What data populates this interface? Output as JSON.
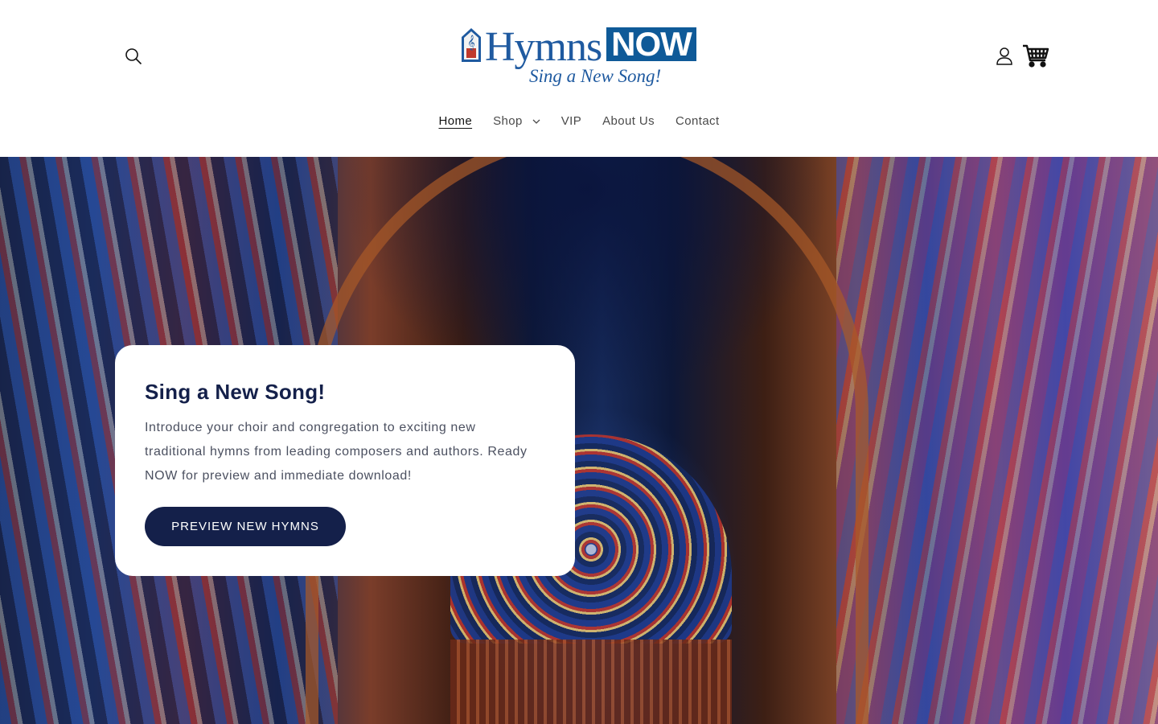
{
  "header": {
    "logo": {
      "word_main": "Hymns",
      "word_accent": "NOW",
      "tagline": "Sing a New Song!"
    },
    "icons": {
      "search": "search-icon",
      "account": "user-icon",
      "cart": "cart-icon"
    }
  },
  "nav": {
    "items": [
      {
        "label": "Home",
        "active": true
      },
      {
        "label": "Shop",
        "has_dropdown": true
      },
      {
        "label": "VIP"
      },
      {
        "label": "About Us"
      },
      {
        "label": "Contact"
      }
    ]
  },
  "hero": {
    "title": "Sing a New Song!",
    "text": "Introduce your choir and congregation to exciting new traditional hymns from leading composers and authors. Ready NOW for preview and immediate download!",
    "cta_label": "PREVIEW NEW HYMNS"
  },
  "colors": {
    "brand_blue": "#1f5aa0",
    "brand_navy": "#14204a",
    "text_gray": "#4b5060"
  }
}
